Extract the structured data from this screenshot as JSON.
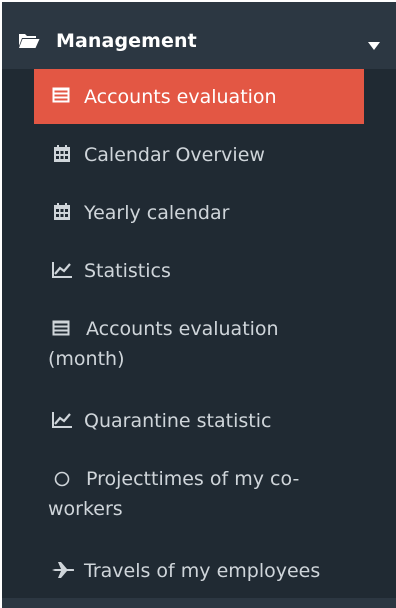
{
  "menu": {
    "header": {
      "title": "Management",
      "icon": "folder-open-icon",
      "caret_icon": "caret-down-icon"
    },
    "items": [
      {
        "label": "Accounts evaluation",
        "icon": "list-alt-icon",
        "active": true
      },
      {
        "label": "Calendar Overview",
        "icon": "calendar-icon"
      },
      {
        "label": "Yearly calendar",
        "icon": "calendar-icon"
      },
      {
        "label": "Statistics",
        "icon": "line-chart-icon"
      },
      {
        "label": "Accounts evaluation (month)",
        "icon": "list-alt-icon"
      },
      {
        "label": "Quarantine statistic",
        "icon": "line-chart-icon"
      },
      {
        "label": "Projecttimes of my co-workers",
        "icon": "circle-outline-icon"
      },
      {
        "label": "Travels of my employees",
        "icon": "plane-icon"
      }
    ]
  },
  "colors": {
    "background": "#202a33",
    "header": "#2c3742",
    "active": "#e35744",
    "text": "#cfd5da"
  }
}
